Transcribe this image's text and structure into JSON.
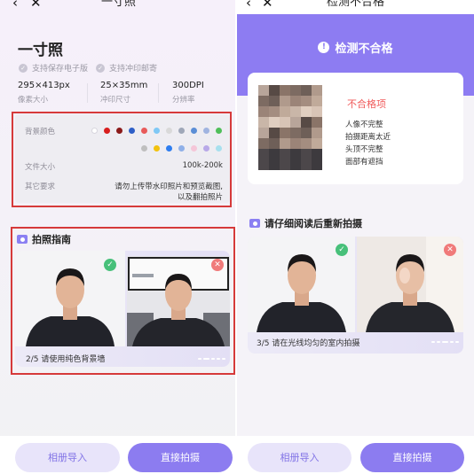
{
  "left": {
    "nav": {
      "back_icon": "chevron-left-icon",
      "close_icon": "close-icon",
      "title": "一寸照"
    },
    "page_title": "一寸照",
    "features": [
      "支持保存电子版",
      "支持冲印邮寄"
    ],
    "specs": [
      {
        "value": "295×413px",
        "label": "像素大小"
      },
      {
        "value": "25×35mm",
        "label": "冲印尺寸"
      },
      {
        "value": "300DPI",
        "label": "分辨率"
      }
    ],
    "info": {
      "bg_color_label": "背景颜色",
      "bg_colors_row1": [
        "#ffffff",
        "#d81e1e",
        "#8b1a1a",
        "#2e5fc7",
        "#e85a5a",
        "#7fc8f5",
        "#d9d9d9",
        "#9fa7b8",
        "#5b8ed6",
        "#a0b4e0",
        "#4fbf59"
      ],
      "bg_colors_row2": [
        "#bfbfbf",
        "#f2c20f",
        "#2d7df0",
        "#8fb0e8",
        "#f5c6d8",
        "#b8a9e8",
        "#a7e0ee"
      ],
      "file_size_label": "文件大小",
      "file_size_value": "100k-200k",
      "other_req_label": "其它要求",
      "other_req_value_1": "请勿上传带水印照片和预览截图,",
      "other_req_value_2": "以及翻拍照片"
    },
    "guide": {
      "title": "拍照指南",
      "caption": "2/5 请使用纯色背景墙",
      "good_badge": "✓",
      "bad_badge": "✕"
    },
    "buttons": {
      "import": "相册导入",
      "shoot": "直接拍摄"
    }
  },
  "right": {
    "nav": {
      "back_icon": "chevron-left-icon",
      "close_icon": "close-icon",
      "title": "检测不合格"
    },
    "banner": "检测不合格",
    "fail_title": "不合格项",
    "reasons": [
      "人像不完整",
      "拍摄距离太近",
      "头顶不完整",
      "面部有遮挡"
    ],
    "section_title": "请仔细阅读后重新拍摄",
    "guide": {
      "caption": "3/5 请在光线均匀的室内拍摄",
      "good_badge": "✓",
      "bad_badge": "✕"
    },
    "buttons": {
      "import": "相册导入",
      "shoot": "直接拍摄"
    }
  },
  "colors": {
    "accent": "#8c7cf0",
    "red_outline": "#d63a3a",
    "fail_red": "#f05a5a",
    "ok_green": "#47c07a"
  }
}
